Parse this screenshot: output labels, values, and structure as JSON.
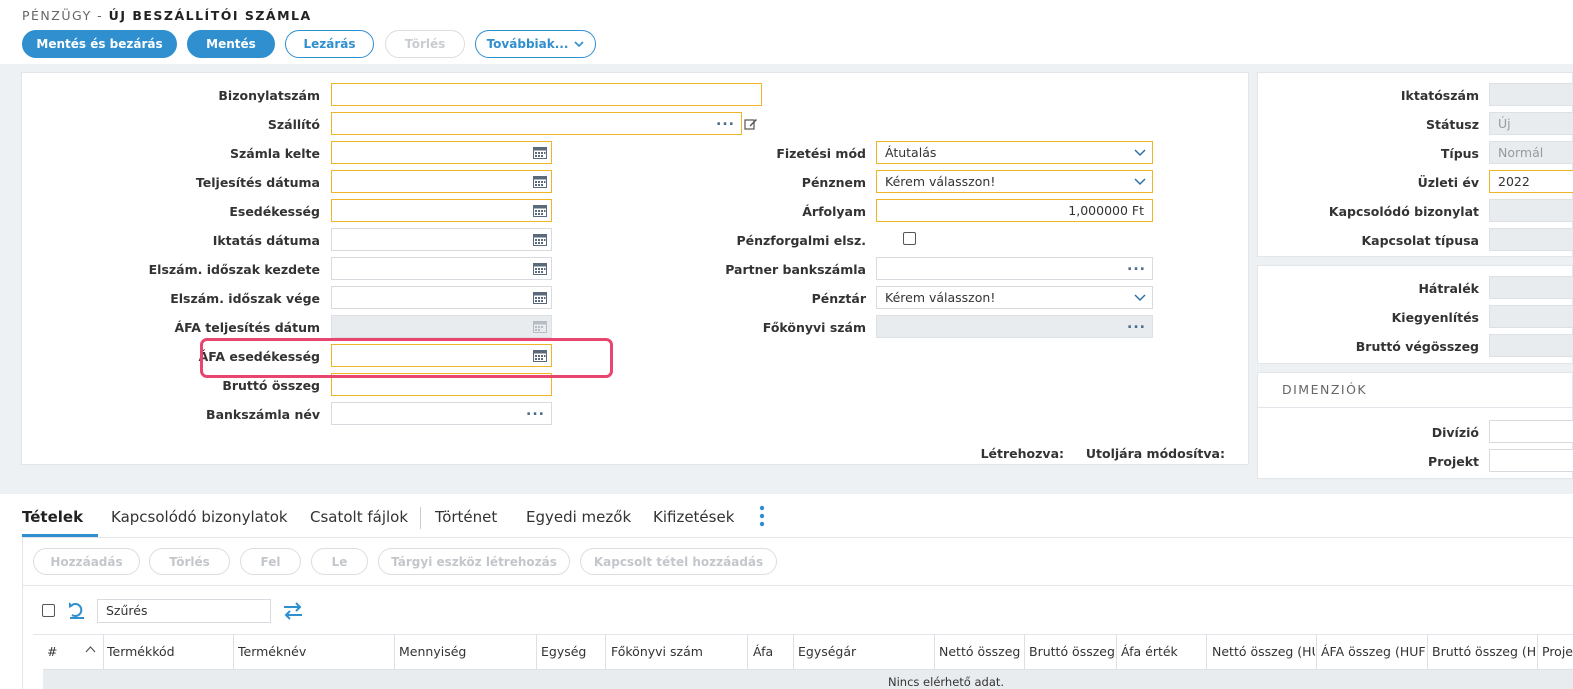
{
  "header": {
    "section": "PÉNZÜGY -",
    "title": "ÚJ BESZÁLLÍTÓI SZÁMLA"
  },
  "toolbar": {
    "save_close": "Mentés és bezárás",
    "save": "Mentés",
    "close": "Lezárás",
    "delete": "Törlés",
    "more": "Továbbiak..."
  },
  "form_left": {
    "bizonylatszam": "Bizonylatszám",
    "szallito": "Szállító",
    "szamla_kelte": "Számla kelte",
    "teljesites_datuma": "Teljesítés dátuma",
    "esedekesseg": "Esedékesség",
    "iktatas_datuma": "Iktatás dátuma",
    "elszam_kezdete": "Elszám. időszak kezdete",
    "elszam_vege": "Elszám. időszak vége",
    "afa_teljesites": "ÁFA teljesítés dátum",
    "afa_esedekesseg": "ÁFA esedékesség",
    "brutto_osszeg": "Bruttó összeg",
    "bankszamla_nev": "Bankszámla név",
    "dots": "..."
  },
  "form_mid": {
    "fizetesi_mod_label": "Fizetési mód",
    "fizetesi_mod_value": "Átutalás",
    "penznem_label": "Pénznem",
    "penznem_value": "Kérem válasszon!",
    "arfolyam_label": "Árfolyam",
    "arfolyam_value": "1,000000 Ft",
    "penzforgalmi_label": "Pénzforgalmi elsz.",
    "partner_bank_label": "Partner bankszámla",
    "penztar_label": "Pénztár",
    "penztar_value": "Kérem válasszon!",
    "fokonyvi_label": "Főkönyvi szám",
    "created_label": "Létrehozva:",
    "modified_label": "Utoljára módosítva:"
  },
  "form_right": {
    "iktatoszam": "Iktatószám",
    "statusz": "Státusz",
    "statusz_value": "Új",
    "tipus": "Típus",
    "tipus_value": "Normál",
    "uzleti_ev": "Üzleti év",
    "uzleti_ev_value": "2022",
    "kapcs_bizonylat": "Kapcsolódó bizonylat",
    "kapcsolat_tipusa": "Kapcsolat típusa",
    "hatralek": "Hátralék",
    "kiegyenlites": "Kiegyenlítés",
    "brutto_vegosszeg": "Bruttó végösszeg",
    "dimenziok": "DIMENZIÓK",
    "divizio": "Divízió",
    "projekt": "Projekt"
  },
  "tabs": {
    "tetelek": "Tételek",
    "kapcs_bizonylatok": "Kapcsolódó bizonylatok",
    "csatolt": "Csatolt fájlok",
    "tortenet": "Történet",
    "egyedi": "Egyedi mezők",
    "kifizetesek": "Kifizetések"
  },
  "actions": {
    "add": "Hozzáadás",
    "delete": "Törlés",
    "up": "Fel",
    "down": "Le",
    "asset": "Tárgyi eszköz létrehozás",
    "linked": "Kapcsolt tétel hozzáadás"
  },
  "filter": {
    "placeholder": "Szűrés"
  },
  "table": {
    "hash": "#",
    "col_termekkod": "Termékkód",
    "col_termeknev": "Terméknév",
    "col_mennyiseg": "Mennyiség",
    "col_egyseg": "Egység",
    "col_fokonyvi": "Főkönyvi szám",
    "col_afa": "Áfa",
    "col_egysegar": "Egységár",
    "col_netto": "Nettó összeg",
    "col_brutto": "Bruttó összeg",
    "col_afa_ertek": "Áfa érték",
    "col_netto_huf": "Nettó összeg (HUF)",
    "col_afa_huf": "ÁFA összeg (HUF)",
    "col_brutto_huf": "Bruttó összeg (HUF)",
    "col_proj": "Projekt",
    "empty": "Nincs elérhető adat."
  }
}
